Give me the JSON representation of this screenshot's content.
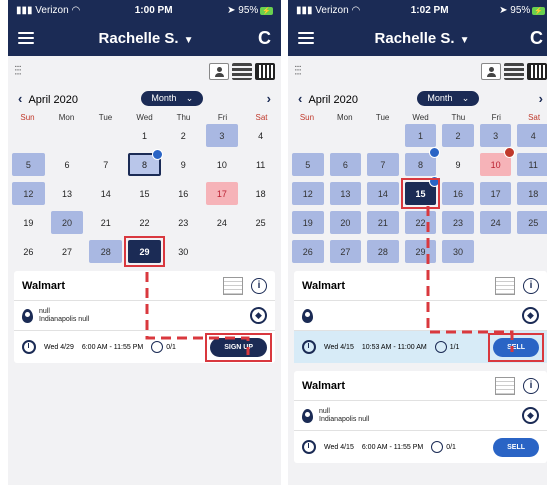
{
  "colors": {
    "navy": "#1b2b55",
    "annotation": "#d9383e"
  },
  "screen1": {
    "status": {
      "carrier": "Verizon",
      "time": "1:00 PM",
      "battery": "95%"
    },
    "header": {
      "title": "Rachelle S.",
      "refresh_icon": "refresh-icon"
    },
    "calendar": {
      "month": "April 2020",
      "view": "Month",
      "weekdays": [
        "Sun",
        "Mon",
        "Tue",
        "Wed",
        "Thu",
        "Fri",
        "Sat"
      ],
      "days": [
        "",
        "",
        "",
        "1",
        "2",
        "3",
        "4",
        "5",
        "6",
        "7",
        "8",
        "9",
        "10",
        "11",
        "12",
        "13",
        "14",
        "15",
        "16",
        "17",
        "18",
        "19",
        "20",
        "21",
        "22",
        "23",
        "24",
        "25",
        "26",
        "27",
        "28",
        "29",
        "30",
        "",
        ""
      ]
    },
    "events": [
      {
        "title": "Walmart",
        "line1": "null",
        "line2": "Indianapolis null",
        "date": "Wed 4/29",
        "time": "6:00 AM - 11:55 PM",
        "count": "0/1",
        "button": "SIGN UP"
      }
    ]
  },
  "screen2": {
    "status": {
      "carrier": "Verizon",
      "time": "1:02 PM",
      "battery": "95%"
    },
    "header": {
      "title": "Rachelle S."
    },
    "calendar": {
      "month": "April 2020",
      "view": "Month",
      "weekdays": [
        "Sun",
        "Mon",
        "Tue",
        "Wed",
        "Thu",
        "Fri",
        "Sat"
      ],
      "days": [
        "",
        "",
        "",
        "1",
        "2",
        "3",
        "4",
        "5",
        "6",
        "7",
        "8",
        "9",
        "10",
        "11",
        "12",
        "13",
        "14",
        "15",
        "16",
        "17",
        "18",
        "19",
        "20",
        "21",
        "22",
        "23",
        "24",
        "25",
        "26",
        "27",
        "28",
        "29",
        "30",
        "",
        ""
      ]
    },
    "events": [
      {
        "title": "Walmart",
        "date": "Wed 4/15",
        "time": "10:53 AM - 11:00 AM",
        "count": "1/1",
        "button": "SELL"
      },
      {
        "title": "Walmart",
        "line1": "null",
        "line2": "Indianapolis null",
        "date": "Wed 4/15",
        "time": "6:00 AM - 11:55 PM",
        "count": "0/1",
        "button": "SELL"
      }
    ]
  }
}
